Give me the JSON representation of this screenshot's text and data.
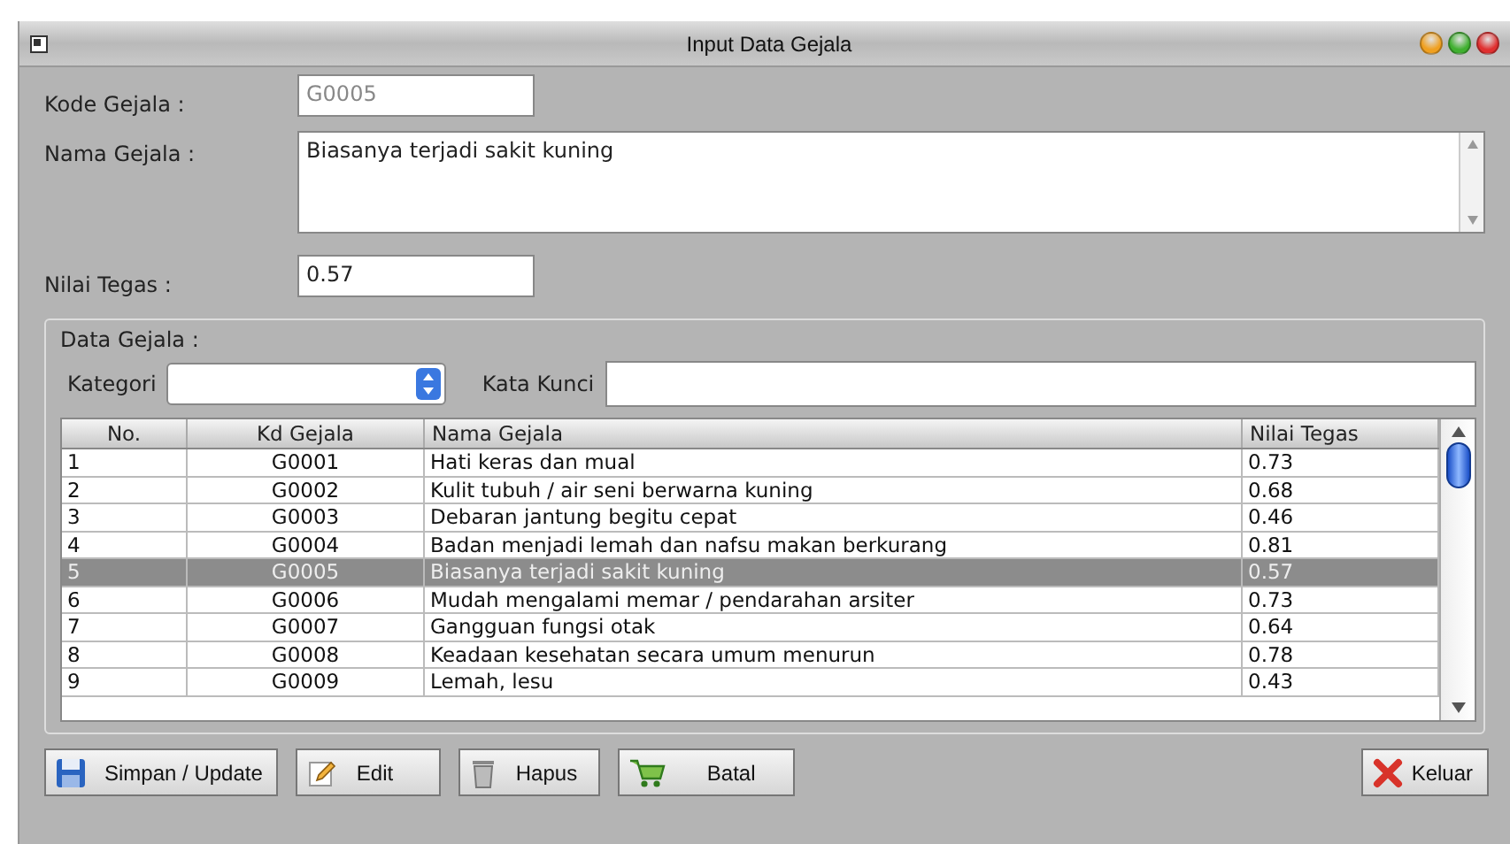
{
  "window": {
    "title": "Input Data Gejala"
  },
  "form": {
    "kode": {
      "label": "Kode Gejala :",
      "value": "G0005",
      "disabled": true
    },
    "nama": {
      "label": "Nama Gejala :",
      "value": "Biasanya terjadi sakit kuning"
    },
    "nilai": {
      "label": "Nilai Tegas :",
      "value": "0.57"
    }
  },
  "group": {
    "title": "Data Gejala :",
    "kategori_label": "Kategori",
    "kata_kunci_label": "Kata Kunci"
  },
  "table": {
    "columns": [
      "No.",
      "Kd Gejala",
      "Nama Gejala",
      "Nilai Tegas"
    ],
    "rows": [
      {
        "cells": [
          "1",
          "G0001",
          "Hati keras dan mual",
          "0.73"
        ],
        "selected": false
      },
      {
        "cells": [
          "2",
          "G0002",
          "Kulit tubuh / air seni berwarna kuning",
          "0.68"
        ],
        "selected": false
      },
      {
        "cells": [
          "3",
          "G0003",
          "Debaran jantung begitu cepat",
          "0.46"
        ],
        "selected": false
      },
      {
        "cells": [
          "4",
          "G0004",
          "Badan menjadi lemah dan nafsu makan berkurang",
          "0.81"
        ],
        "selected": false
      },
      {
        "cells": [
          "5",
          "G0005",
          "Biasanya terjadi sakit kuning",
          "0.57"
        ],
        "selected": true
      },
      {
        "cells": [
          "6",
          "G0006",
          "Mudah mengalami memar / pendarahan arsiter",
          "0.73"
        ],
        "selected": false
      },
      {
        "cells": [
          "7",
          "G0007",
          "Gangguan fungsi otak",
          "0.64"
        ],
        "selected": false
      },
      {
        "cells": [
          "8",
          "G0008",
          "Keadaan kesehatan secara umum menurun",
          "0.78"
        ],
        "selected": false
      },
      {
        "cells": [
          "9",
          "G0009",
          "Lemah, lesu",
          "0.43"
        ],
        "selected": false
      }
    ]
  },
  "buttons": [
    {
      "label": "Simpan / Update",
      "kind": "save"
    },
    {
      "label": "Edit",
      "kind": "edit"
    },
    {
      "label": "Hapus",
      "kind": "delete"
    },
    {
      "label": "Batal",
      "kind": "cancel"
    }
  ],
  "exit_button": {
    "label": "Keluar",
    "kind": "exit"
  }
}
